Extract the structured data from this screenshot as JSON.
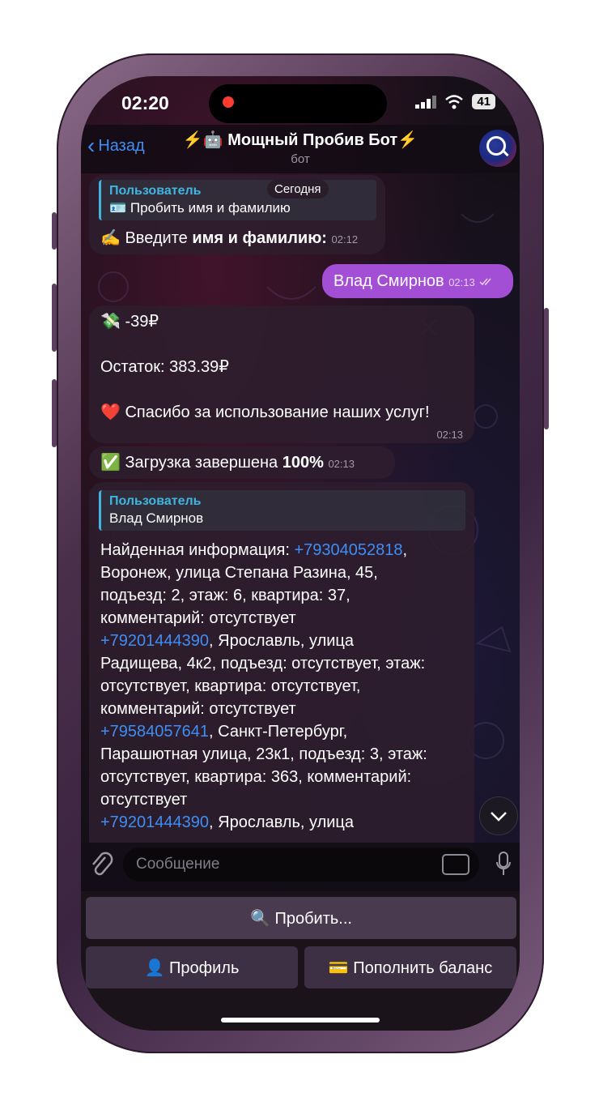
{
  "status": {
    "time": "02:20",
    "battery": "41"
  },
  "header": {
    "back_label": "Назад",
    "title": "⚡️🤖 Мощный Пробив Бот⚡️",
    "subtitle": "бот"
  },
  "date_pill": "Сегодня",
  "messages": [
    {
      "quote_name": "Пользователь",
      "quote_text": "🪪 Пробить имя и фамилию",
      "text_pre": "✍️ Введите ",
      "text_bold": "имя и фамилию:",
      "time": "02:12"
    },
    {
      "text": "Влад Смирнов",
      "time": "02:13",
      "read_icon": "double-check-icon"
    },
    {
      "line1": "💸 -39₽",
      "line2": "Остаток: 383.39₽",
      "line3": "❤️ Спасибо за использование наших услуг!",
      "time": "02:13"
    },
    {
      "text_pre": "✅ Загрузка завершена ",
      "text_bold": "100%",
      "time": "02:13"
    },
    {
      "quote_name": "Пользователь",
      "quote_text": "Влад Смирнов",
      "body": [
        {
          "pre": "Найденная информация: ",
          "link": "+79304052818",
          "post": ","
        },
        {
          "pre": "Воронеж, улица Степана Разина, 45,",
          "link": "",
          "post": ""
        },
        {
          "pre": "подъезд: 2, этаж: 6, квартира: 37,",
          "link": "",
          "post": ""
        },
        {
          "pre": "комментарий: отсутствует",
          "link": "",
          "post": ""
        },
        {
          "pre": "",
          "link": "+79201444390",
          "post": ", Ярославль, улица"
        },
        {
          "pre": "Радищева, 4к2, подъезд: отсутствует, этаж:",
          "link": "",
          "post": ""
        },
        {
          "pre": "отсутствует, квартира: отсутствует,",
          "link": "",
          "post": ""
        },
        {
          "pre": "комментарий: отсутствует",
          "link": "",
          "post": ""
        },
        {
          "pre": "",
          "link": "+79584057641",
          "post": ", Санкт-Петербург,"
        },
        {
          "pre": "Парашютная улица, 23к1, подъезд: 3, этаж:",
          "link": "",
          "post": ""
        },
        {
          "pre": "отсутствует, квартира: 363, комментарий:",
          "link": "",
          "post": ""
        },
        {
          "pre": "отсутствует",
          "link": "",
          "post": ""
        },
        {
          "pre": "",
          "link": "+79201444390",
          "post": ", Ярославль, улица"
        }
      ]
    }
  ],
  "input": {
    "placeholder": "Сообщение"
  },
  "keyboard": {
    "probe": "🔍 Пробить...",
    "profile": "👤 Профиль",
    "topup": "💳 Пополнить баланс"
  },
  "colors": {
    "accent": "#3e8ef5",
    "outgoing": "#a24fd6",
    "quote": "#3fb5e0"
  }
}
